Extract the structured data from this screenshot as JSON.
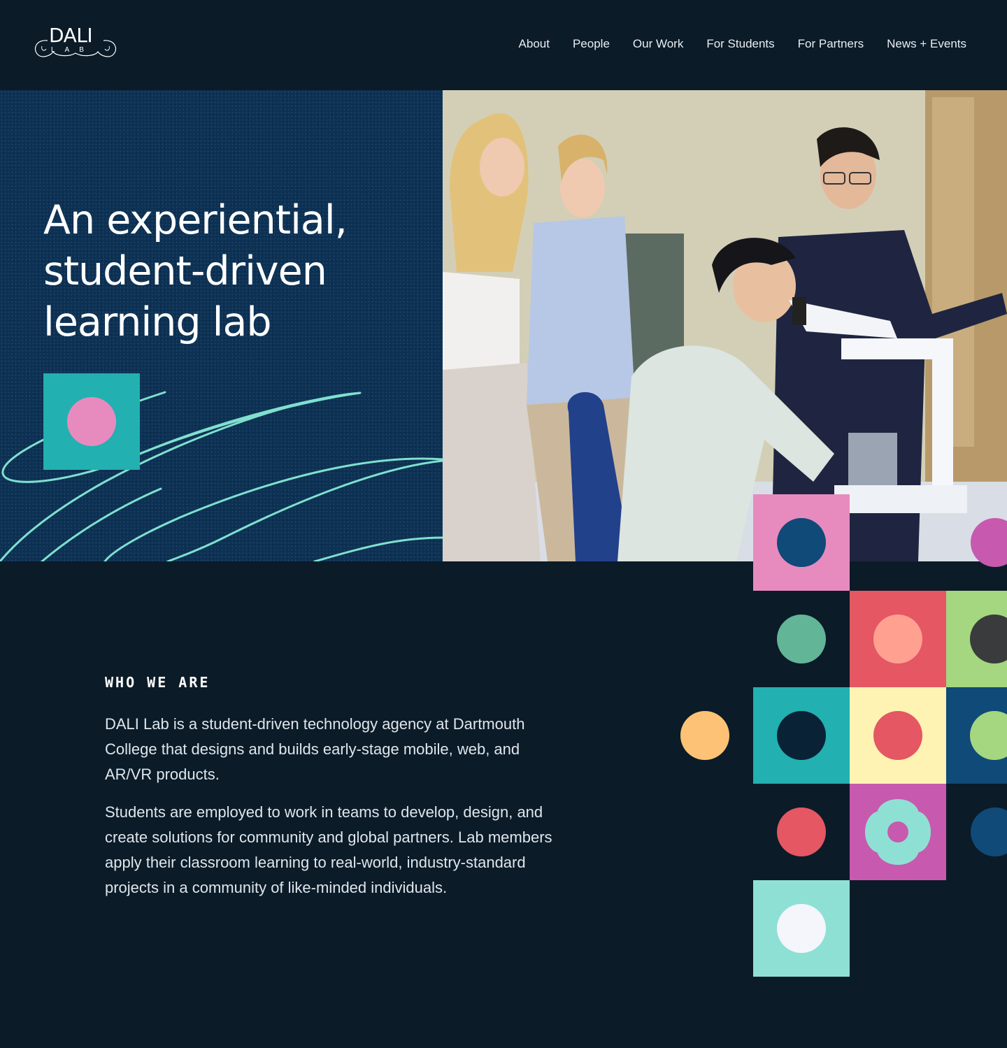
{
  "header": {
    "logo": {
      "word": "DALI",
      "sub": "LAB"
    },
    "nav": [
      "About",
      "People",
      "Our Work",
      "For Students",
      "For Partners",
      "News + Events"
    ]
  },
  "hero": {
    "title": "An experiential, student-driven learning lab"
  },
  "who": {
    "label": "WHO WE ARE",
    "paragraphs": [
      "DALI Lab is a student-driven technology agency at Dartmouth College that designs and builds early-stage mobile, web, and AR/VR products.",
      "Students are employed to work in teams to develop, design, and create solutions for community and global partners. Lab members apply their classroom learning to real-world, industry-standard projects in a community of like-minded individuals."
    ]
  },
  "colors": {
    "background": "#0b1b28",
    "hero_panel": "#0d3153",
    "teal": "#22b0b1",
    "pink": "#e78bbf",
    "scribble": "#7fe0cf"
  }
}
